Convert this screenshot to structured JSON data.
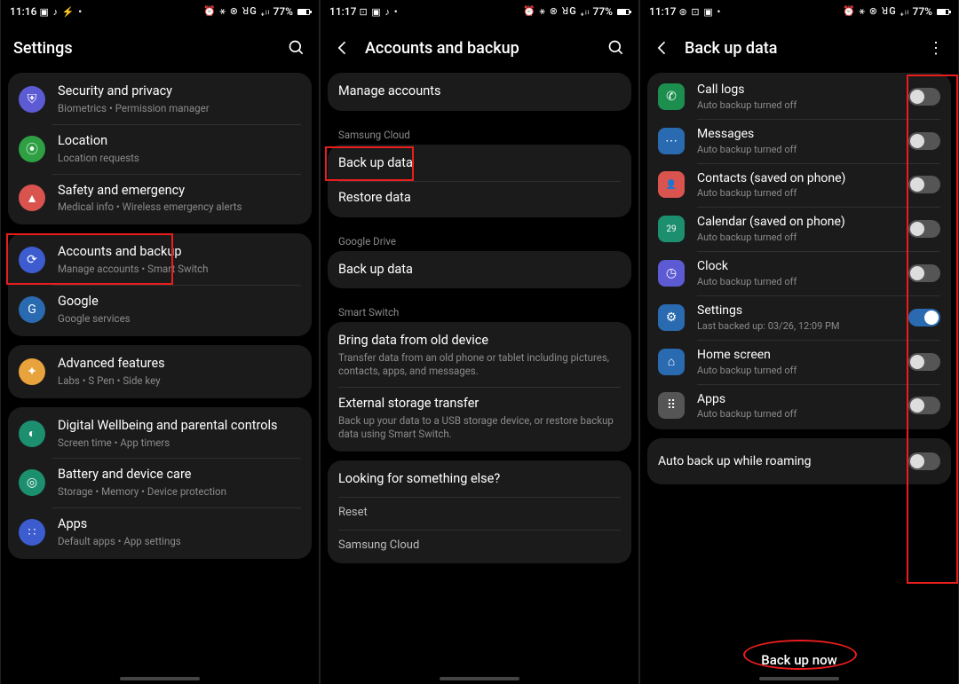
{
  "screens": [
    {
      "time": "11:16",
      "status_left_icons": "▣ ♪ ⚡ •",
      "status_right_icons": "⏰ ⚹ ⊗ ꓤG ₊ᵢₗ",
      "battery": "77%",
      "title": "Settings",
      "groups": [
        [
          {
            "icon": "shield-icon",
            "bg": "#5d5bd4",
            "glyph": "⛨",
            "label": "Security and privacy",
            "sub": "Biometrics  •  Permission manager"
          },
          {
            "icon": "location-icon",
            "bg": "#2ea043",
            "glyph": "⦿",
            "label": "Location",
            "sub": "Location requests"
          },
          {
            "icon": "emergency-icon",
            "bg": "#d9534f",
            "glyph": "▲",
            "label": "Safety and emergency",
            "sub": "Medical info  •  Wireless emergency alerts"
          }
        ],
        [
          {
            "icon": "sync-icon",
            "bg": "#3c5ccf",
            "glyph": "⟳",
            "label": "Accounts and backup",
            "sub": "Manage accounts  •  Smart Switch",
            "hl": true
          },
          {
            "icon": "google-icon",
            "bg": "#2a6ab0",
            "glyph": "G",
            "label": "Google",
            "sub": "Google services"
          }
        ],
        [
          {
            "icon": "adv-icon",
            "bg": "#e8a33d",
            "glyph": "✦",
            "label": "Advanced features",
            "sub": "Labs  •  S Pen  •  Side key"
          }
        ],
        [
          {
            "icon": "wellbeing-icon",
            "bg": "#1c8f6f",
            "glyph": "◐",
            "label": "Digital Wellbeing and parental controls",
            "sub": "Screen time  •  App timers"
          },
          {
            "icon": "battery-icon",
            "bg": "#1c8f6f",
            "glyph": "◎",
            "label": "Battery and device care",
            "sub": "Storage  •  Memory  •  Device protection"
          },
          {
            "icon": "apps-icon",
            "bg": "#3c5ccf",
            "glyph": "∷",
            "label": "Apps",
            "sub": "Default apps  •  App settings"
          }
        ]
      ]
    },
    {
      "time": "11:17",
      "status_left_icons": "⊡ ▣ ♪ •",
      "status_right_icons": "⏰ ⚹ ⊗ ꓤG ₊ᵢₗ",
      "battery": "77%",
      "title": "Accounts and backup",
      "cards": [
        {
          "rows": [
            {
              "label": "Manage accounts"
            }
          ]
        },
        {
          "header": "Samsung Cloud",
          "rows": [
            {
              "label": "Back up data",
              "hl": true
            },
            {
              "label": "Restore data"
            }
          ]
        },
        {
          "header": "Google Drive",
          "rows": [
            {
              "label": "Back up data"
            }
          ]
        },
        {
          "header": "Smart Switch",
          "rows": [
            {
              "label": "Bring data from old device",
              "sub": "Transfer data from an old phone or tablet including pictures, contacts, apps, and messages."
            },
            {
              "label": "External storage transfer",
              "sub": "Back up your data to a USB storage device, or restore backup data using Smart Switch."
            }
          ]
        },
        {
          "rows": [
            {
              "label": "Looking for something else?"
            },
            {
              "label": "Reset",
              "small": true
            },
            {
              "label": "Samsung Cloud",
              "small": true
            }
          ]
        }
      ]
    },
    {
      "time": "11:17",
      "status_left_icons": "⊛ ⊡ ▣ •",
      "status_right_icons": "⏰ ⚹ ⊗ ꓤG ₊ᵢₗ",
      "battery": "77%",
      "title": "Back up data",
      "off_sub": "Auto backup turned off",
      "items": [
        {
          "icon": "phone-icon",
          "bg": "#1c8f4f",
          "glyph": "✆",
          "label": "Call logs",
          "sub": "Auto backup turned off",
          "on": false
        },
        {
          "icon": "messages-icon",
          "bg": "#2a6ab0",
          "glyph": "⋯",
          "label": "Messages",
          "sub": "Auto backup turned off",
          "on": false
        },
        {
          "icon": "contacts-icon",
          "bg": "#d9534f",
          "glyph": "👤",
          "label": "Contacts (saved on phone)",
          "sub": "Auto backup turned off",
          "on": false
        },
        {
          "icon": "calendar-icon",
          "bg": "#1c8f6f",
          "glyph": "29",
          "label": "Calendar (saved on phone)",
          "sub": "Auto backup turned off",
          "on": false
        },
        {
          "icon": "clock-icon",
          "bg": "#5d5bd4",
          "glyph": "◷",
          "label": "Clock",
          "sub": "Auto backup turned off",
          "on": false
        },
        {
          "icon": "settings-icon",
          "bg": "#2a6ab0",
          "glyph": "⚙",
          "label": "Settings",
          "sub": "Last backed up: 03/26, 12:09 PM",
          "on": true
        },
        {
          "icon": "home-icon",
          "bg": "#2a6ab0",
          "glyph": "⌂",
          "label": "Home screen",
          "sub": "Auto backup turned off",
          "on": false
        },
        {
          "icon": "apps-icon",
          "bg": "#555",
          "glyph": "⠿",
          "label": "Apps",
          "sub": "Auto backup turned off",
          "on": false
        }
      ],
      "roaming": {
        "label": "Auto back up while roaming",
        "on": false
      },
      "action": "Back up now"
    }
  ]
}
